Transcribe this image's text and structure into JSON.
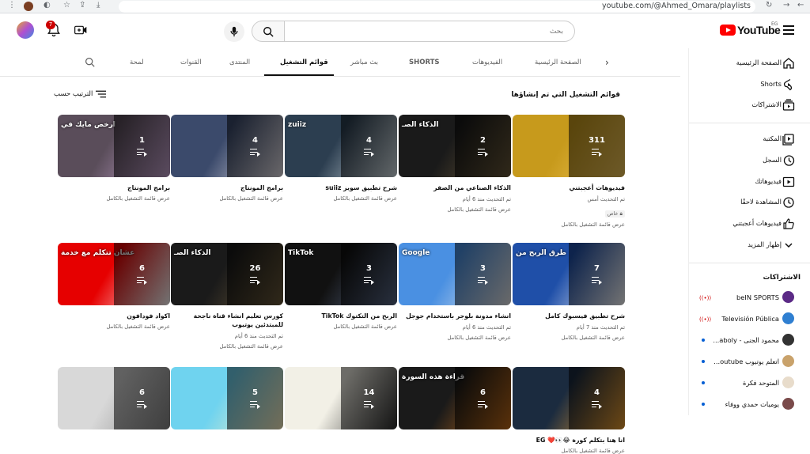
{
  "browser": {
    "url": "youtube.com/@Ahmed_Omara/playlists"
  },
  "masthead": {
    "logo_text": "YouTube",
    "country_code": "EG",
    "search_placeholder": "بحث",
    "notification_count": "7"
  },
  "tabs": [
    {
      "label": "الصفحة الرئيسية"
    },
    {
      "label": "الفيديوهات"
    },
    {
      "label": "SHORTS"
    },
    {
      "label": "بث مباشر"
    },
    {
      "label": "قوائم التشغيل",
      "active": true
    },
    {
      "label": "المنتدى"
    },
    {
      "label": "القنوات"
    },
    {
      "label": "لمحة"
    }
  ],
  "section": {
    "title": "قوائم التشغيل التي تم إنشاؤها",
    "sort_label": "الترتيب حسب"
  },
  "playlists": [
    {
      "title": "فيديوهات أعجبتني",
      "count": "311",
      "updated": "تم التحديث أمس",
      "privacy": "خاص",
      "view": "عرض قائمة التشغيل بالكامل",
      "colors": [
        "#c79a1c",
        "#f2c65a"
      ]
    },
    {
      "title": "الذكاء الصناعي من الصفر",
      "count": "2",
      "updated": "تم التحديث منذ 6 أيام",
      "view": "عرض قائمة التشغيل بالكامل",
      "colors": [
        "#1a1a1a",
        "#6b5a3a"
      ],
      "caption": "الذكاء الصـ"
    },
    {
      "title": "شرح تطبيق سويز suiiz",
      "count": "4",
      "updated": "",
      "view": "عرض قائمة التشغيل بالكامل",
      "colors": [
        "#2c3e50",
        "#d9e4e9"
      ],
      "caption": "zuiiz"
    },
    {
      "title": "برامج المونتاج",
      "count": "4",
      "updated": "",
      "view": "عرض قائمة التشغيل بالكامل",
      "colors": [
        "#3b4a6b",
        "#e9e4ea"
      ]
    },
    {
      "title": "برامج المونتاج",
      "count": "1",
      "updated": "",
      "view": "عرض قائمة التشغيل بالكامل",
      "colors": [
        "#5a4d5a",
        "#c9a7d3"
      ],
      "caption": "ارخص مايك في"
    },
    {
      "title": "شرح تطبيق فيسبوك كامل",
      "count": "7",
      "updated": "تم التحديث منذ 7 أيام",
      "view": "عرض قائمة التشغيل بالكامل",
      "colors": [
        "#1f4fa8",
        "#ffffff"
      ],
      "caption": "طرق الربح من"
    },
    {
      "title": "انشاء مدونة بلوجر باستخدام جوجل",
      "count": "3",
      "updated": "تم التحديث منذ 6 أيام",
      "view": "عرض قائمة التشغيل بالكامل",
      "colors": [
        "#4a90e2",
        "#eaeaea"
      ],
      "caption": "Google"
    },
    {
      "title": "الربح من التكتوك TikTok",
      "count": "3",
      "updated": "",
      "view": "عرض قائمة التشغيل بالكامل",
      "colors": [
        "#111111",
        "#5b6b8a"
      ],
      "caption": "TikTok"
    },
    {
      "title": "كورس تعليم انشاء قناة ناجحة للمبتدئين يوتيوب",
      "count": "26",
      "updated": "تم التحديث منذ 6 أيام",
      "view": "عرض قائمة التشغيل بالكامل",
      "colors": [
        "#1a1a1a",
        "#6b5a3a"
      ],
      "caption": "الذكاء الصـ"
    },
    {
      "title": "اكواد فودافون",
      "count": "6",
      "updated": "",
      "view": "عرض قائمة التشغيل بالكامل",
      "colors": [
        "#e60000",
        "#ffffff"
      ],
      "caption": "عشان تتكلم مع خدمة"
    },
    {
      "title": "انا هنا بتكلم كورة 😂👀❤️ EG",
      "count": "4",
      "updated": "",
      "view": "عرض قائمة التشغيل بالكامل",
      "colors": [
        "#1b2b3f",
        "#f0a030"
      ]
    },
    {
      "title": "",
      "count": "6",
      "updated": "",
      "view": "",
      "colors": [
        "#1a1a1a",
        "#c66d1a"
      ],
      "caption": "قراءة هذه السورة"
    },
    {
      "title": "",
      "count": "14",
      "updated": "",
      "view": "",
      "colors": [
        "#f2f0e6",
        "#2c2c2c"
      ]
    },
    {
      "title": "",
      "count": "5",
      "updated": "",
      "view": "",
      "colors": [
        "#6fd3ef",
        "#fff3c4"
      ]
    },
    {
      "title": "",
      "count": "6",
      "updated": "",
      "view": "",
      "colors": [
        "#d8d8d8",
        "#8a8a8a"
      ]
    }
  ],
  "sidebar": {
    "main": [
      {
        "label": "الصفحة الرئيسية",
        "icon": "home-icon"
      },
      {
        "label": "Shorts",
        "icon": "shorts-icon"
      },
      {
        "label": "الاشتراكات",
        "icon": "subscriptions-icon"
      }
    ],
    "library": [
      {
        "label": "المكتبة",
        "icon": "library-icon"
      },
      {
        "label": "السجل",
        "icon": "history-icon"
      },
      {
        "label": "فيديوهاتك",
        "icon": "your-videos-icon"
      },
      {
        "label": "المشاهدة لاحقًا",
        "icon": "watch-later-icon"
      },
      {
        "label": "فيديوهات أعجبتني",
        "icon": "liked-icon"
      },
      {
        "label": "إظهار المزيد",
        "icon": "chevron-down-icon"
      }
    ],
    "subs_header": "الاشتراكات",
    "subscriptions": [
      {
        "label": "beIN SPORTS",
        "indicator": "live",
        "avatar_color": "#5b2a86"
      },
      {
        "label": "Televisión Pública",
        "indicator": "live",
        "avatar_color": "#2f7fd1"
      },
      {
        "label": "محمود الجنى - aboly...",
        "indicator": "dot",
        "avatar_color": "#333333"
      },
      {
        "label": "اتعلم يوتيوب outube...",
        "indicator": "dot",
        "avatar_color": "#c9a26b"
      },
      {
        "label": "المتوحد فكرة",
        "indicator": "dot",
        "avatar_color": "#e8dccb"
      },
      {
        "label": "يوميات حمدي ووفاء",
        "indicator": "dot",
        "avatar_color": "#7a4a4a"
      }
    ]
  }
}
